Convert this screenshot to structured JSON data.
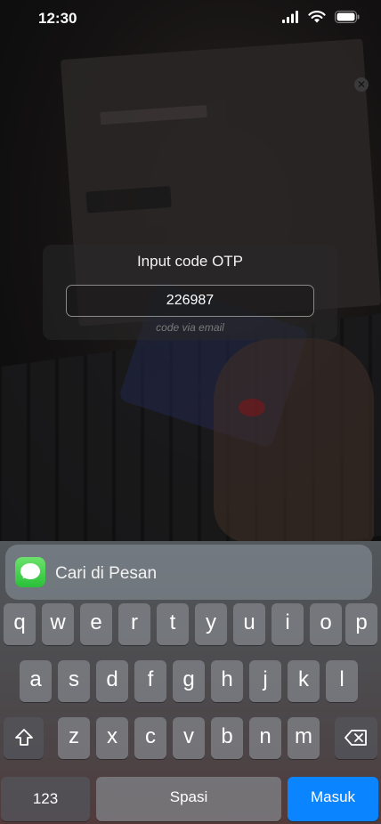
{
  "status_bar": {
    "time": "12:30"
  },
  "otp": {
    "title": "Input code OTP",
    "value": "226987",
    "hint": "code via email"
  },
  "keyboard": {
    "suggestion": {
      "icon": "messages-app-icon",
      "label": "Cari di Pesan"
    },
    "row1": [
      "q",
      "w",
      "e",
      "r",
      "t",
      "y",
      "u",
      "i",
      "o",
      "p"
    ],
    "row2": [
      "a",
      "s",
      "d",
      "f",
      "g",
      "h",
      "j",
      "k",
      "l"
    ],
    "row3": [
      "z",
      "x",
      "c",
      "v",
      "b",
      "n",
      "m"
    ],
    "numbers_label": "123",
    "space_label": "Spasi",
    "enter_label": "Masuk"
  },
  "colors": {
    "accent": "#0a84ff",
    "messages_green": "#34c759"
  }
}
